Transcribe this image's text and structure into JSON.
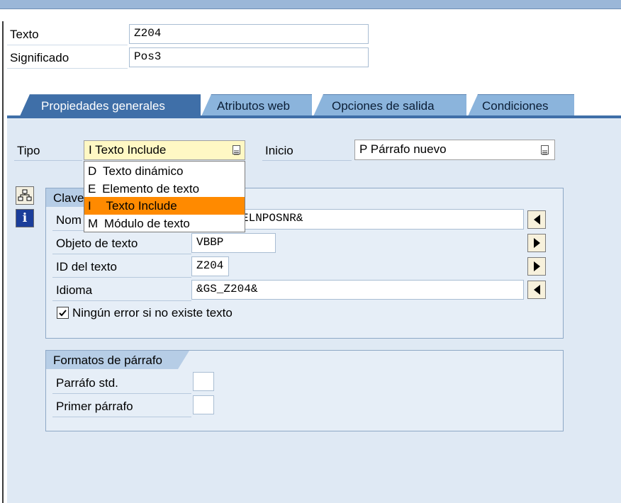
{
  "header": {
    "texto_label": "Texto",
    "texto_value": "Z204",
    "significado_label": "Significado",
    "significado_value": "Pos3"
  },
  "tabs": [
    {
      "label": "Propiedades generales",
      "active": true
    },
    {
      "label": "Atributos web",
      "active": false
    },
    {
      "label": "Opciones de salida",
      "active": false
    },
    {
      "label": "Condiciones",
      "active": false
    }
  ],
  "tipo": {
    "label": "Tipo",
    "selected": "I Texto Include",
    "options": [
      {
        "key": "D",
        "text": "Texto dinámico"
      },
      {
        "key": "E",
        "text": "Elemento de texto"
      },
      {
        "key": "I",
        "text": "Texto Include"
      },
      {
        "key": "M",
        "text": "Módulo de texto"
      }
    ]
  },
  "inicio": {
    "label": "Inicio",
    "selected": "P Párrafo nuevo"
  },
  "clave": {
    "title": "Clave",
    "nombre_label": "Nom",
    "nombre_value": "ELNPOSNR&",
    "objeto_label": "Objeto de texto",
    "objeto_value": "VBBP",
    "id_label": "ID del texto",
    "id_value": "Z204",
    "idioma_label": "Idioma",
    "idioma_value": "&GS_Z204&",
    "checkbox_label": "Ningún error si no existe texto",
    "checkbox_checked": true
  },
  "formatos": {
    "title": "Formatos de párrafo",
    "std_label": "Parráfo std.",
    "std_value": "",
    "primer_label": "Primer párrafo",
    "primer_value": ""
  },
  "icons": {
    "tool1": "tree-structure-icon",
    "tool2": "info-icon"
  },
  "colors": {
    "active_tab": "#3f6fa8",
    "inactive_tab": "#8bb4dc",
    "selection": "#ff8a00",
    "combo_yellow": "#fff8c4"
  }
}
